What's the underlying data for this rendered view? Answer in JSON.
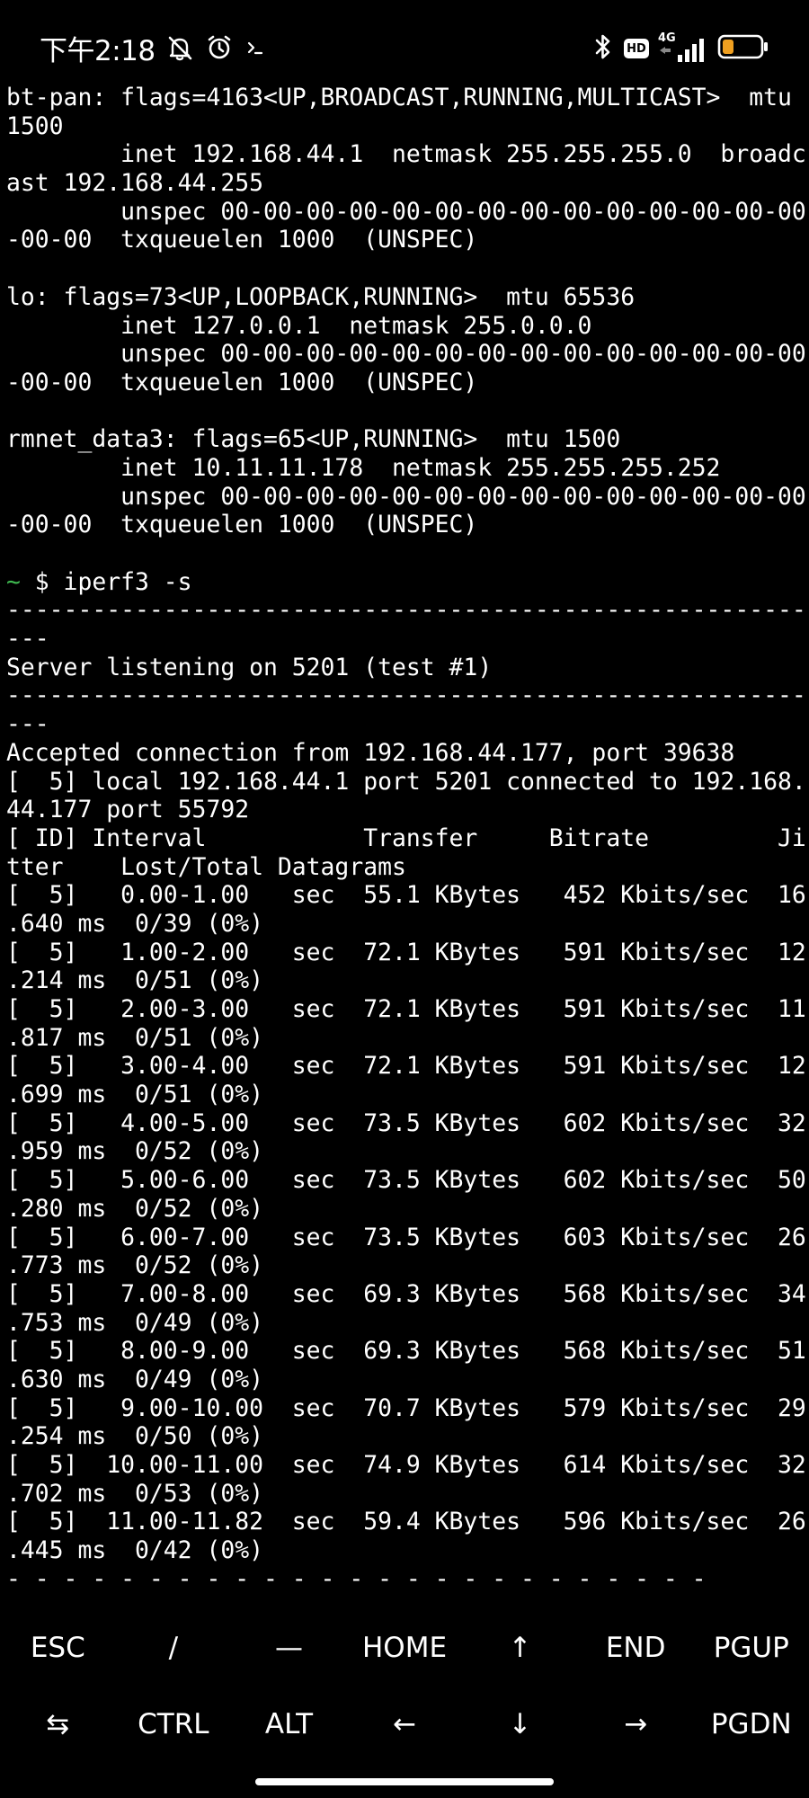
{
  "status_bar": {
    "time": "下午2:18",
    "icons": [
      "mute-bell-icon",
      "alarm-clock-icon",
      "terminal-prompt-icon",
      "bluetooth-icon",
      "hd-voice-icon",
      "signal-4g-icon",
      "battery-icon"
    ],
    "hd_label": "HD",
    "network_label": "4G",
    "battery_level": 0.3,
    "battery_color": "#f0a020"
  },
  "terminal": {
    "lines": [
      "bt-pan: flags=4163<UP,BROADCAST,RUNNING,MULTICAST>  mtu",
      "1500",
      "        inet 192.168.44.1  netmask 255.255.255.0  broadc",
      "ast 192.168.44.255",
      "        unspec 00-00-00-00-00-00-00-00-00-00-00-00-00-00",
      "-00-00  txqueuelen 1000  (UNSPEC)",
      "",
      "lo: flags=73<UP,LOOPBACK,RUNNING>  mtu 65536",
      "        inet 127.0.0.1  netmask 255.0.0.0",
      "        unspec 00-00-00-00-00-00-00-00-00-00-00-00-00-00",
      "-00-00  txqueuelen 1000  (UNSPEC)",
      "",
      "rmnet_data3: flags=65<UP,RUNNING>  mtu 1500",
      "        inet 10.11.11.178  netmask 255.255.255.252",
      "        unspec 00-00-00-00-00-00-00-00-00-00-00-00-00-00",
      "-00-00  txqueuelen 1000  (UNSPEC)",
      "",
      "~ $ iperf3 -s",
      "--------------------------------------------------------",
      "---",
      "Server listening on 5201 (test #1)",
      "--------------------------------------------------------",
      "---",
      "Accepted connection from 192.168.44.177, port 39638",
      "[  5] local 192.168.44.1 port 5201 connected to 192.168.",
      "44.177 port 55792",
      "[ ID] Interval           Transfer     Bitrate         Ji",
      "tter    Lost/Total Datagrams",
      "[  5]   0.00-1.00   sec  55.1 KBytes   452 Kbits/sec  16",
      ".640 ms  0/39 (0%)",
      "[  5]   1.00-2.00   sec  72.1 KBytes   591 Kbits/sec  12",
      ".214 ms  0/51 (0%)",
      "[  5]   2.00-3.00   sec  72.1 KBytes   591 Kbits/sec  11",
      ".817 ms  0/51 (0%)",
      "[  5]   3.00-4.00   sec  72.1 KBytes   591 Kbits/sec  12",
      ".699 ms  0/51 (0%)",
      "[  5]   4.00-5.00   sec  73.5 KBytes   602 Kbits/sec  32",
      ".959 ms  0/52 (0%)",
      "[  5]   5.00-6.00   sec  73.5 KBytes   602 Kbits/sec  50",
      ".280 ms  0/52 (0%)",
      "[  5]   6.00-7.00   sec  73.5 KBytes   603 Kbits/sec  26",
      ".773 ms  0/52 (0%)",
      "[  5]   7.00-8.00   sec  69.3 KBytes   568 Kbits/sec  34",
      ".753 ms  0/49 (0%)",
      "[  5]   8.00-9.00   sec  69.3 KBytes   568 Kbits/sec  51",
      ".630 ms  0/49 (0%)",
      "[  5]   9.00-10.00  sec  70.7 KBytes   579 Kbits/sec  29",
      ".254 ms  0/50 (0%)",
      "[  5]  10.00-11.00  sec  74.9 KBytes   614 Kbits/sec  32",
      ".702 ms  0/53 (0%)",
      "[  5]  11.00-11.82  sec  59.4 KBytes   596 Kbits/sec  26",
      ".445 ms  0/42 (0%)",
      "- - - - - - - - - - - - - - - - - - - - - - - - -"
    ],
    "prompt_symbol": "~",
    "prompt_color": "#3fb950"
  },
  "extra_keys": {
    "row1": [
      "ESC",
      "/",
      "—",
      "HOME",
      "↑",
      "END",
      "PGUP"
    ],
    "row2": [
      "⇆",
      "CTRL",
      "ALT",
      "←",
      "↓",
      "→",
      "PGDN"
    ]
  }
}
